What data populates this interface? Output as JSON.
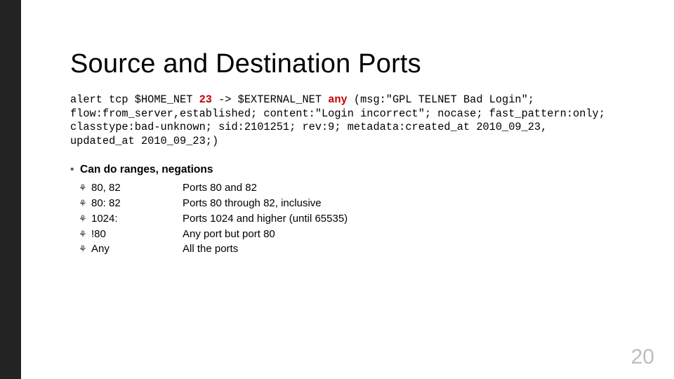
{
  "title": "Source and Destination Ports",
  "rule": {
    "pre1": "alert tcp $HOME_NET ",
    "em1": "23",
    "mid1": " -> $EXTERNAL_NET ",
    "em2": "any",
    "post": " (msg:\"GPL TELNET Bad Login\"; flow:from_server,established; content:\"Login incorrect\"; nocase; fast_pattern:only; classtype:bad-unknown; sid:2101251; rev:9; metadata:created_at 2010_09_23, updated_at 2010_09_23;)"
  },
  "sub_bullet": "•",
  "subheading": "Can do ranges, negations",
  "bullet_glyph": "⚘",
  "rows": [
    {
      "c1": "80, 82",
      "c2": "Ports 80 and 82"
    },
    {
      "c1": "80: 82",
      "c2": "Ports 80 through 82, inclusive"
    },
    {
      "c1": "1024:",
      "c2": "Ports 1024 and higher (until 65535)"
    },
    {
      "c1": "!80",
      "c2": "Any port but port 80"
    },
    {
      "c1": "Any",
      "c2": "All the ports"
    }
  ],
  "slide_number": "20"
}
